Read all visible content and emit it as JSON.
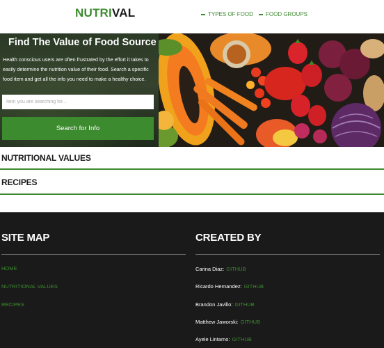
{
  "logo": {
    "green_part": "NUTRI",
    "dark_part": "VAL"
  },
  "nav": [
    {
      "label": "TYPES OF FOOD"
    },
    {
      "label": "FOOD GROUPS"
    }
  ],
  "hero": {
    "title": "Find The Value of Food Source",
    "description": "Health conscious users are often frustrated by the effort it takes to easily determine the nutrition value of their food. Search a specific food item and get all the info you need to make a healthy choice.",
    "search_placeholder": "Item you are searching for...",
    "search_button": "Search for Info"
  },
  "sections": [
    {
      "title": "NUTRITIONAL VALUES"
    },
    {
      "title": "RECIPES"
    }
  ],
  "footer": {
    "site_map_title": "SITE MAP",
    "site_links": [
      "HOME",
      "NUTRITIONAL VALUES",
      "RECIPES"
    ],
    "created_by_title": "CREATED BY",
    "creators": [
      {
        "name": "Carina Diaz:",
        "link": "GITHUB"
      },
      {
        "name": "Ricardo Hernandez:",
        "link": "GITHUB"
      },
      {
        "name": "Brandon Javillo:",
        "link": "GITHUB"
      },
      {
        "name": "Matthew Jaworski:",
        "link": "GITHUB"
      },
      {
        "name": "Ayele Lintamo:",
        "link": "GITHUB"
      }
    ]
  },
  "colors": {
    "accent": "#3d8b2f",
    "footer_bg": "#1a1a1a"
  }
}
